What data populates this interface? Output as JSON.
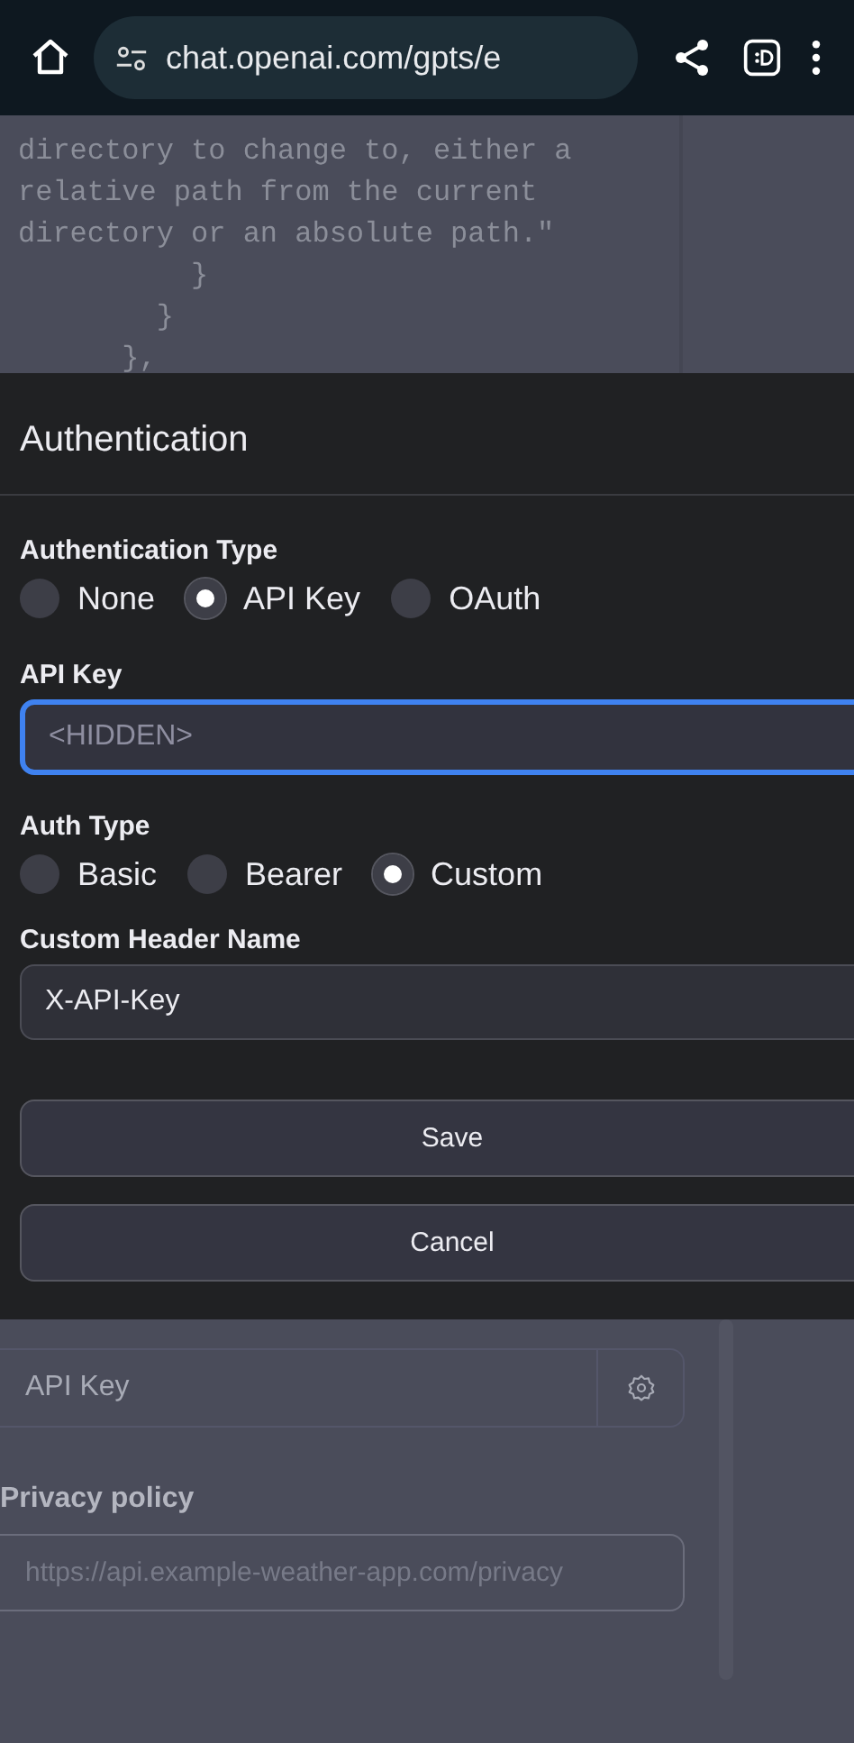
{
  "browser": {
    "url": "chat.openai.com/gpts/e"
  },
  "background_code": {
    "lines": [
      "directory to change to, either a",
      "relative path from the current",
      "directory or an absolute path.\"",
      "          }",
      "        }",
      "      },"
    ]
  },
  "dialog": {
    "title": "Authentication",
    "auth_type_label": "Authentication Type",
    "auth_types": [
      {
        "label": "None",
        "selected": false
      },
      {
        "label": "API Key",
        "selected": true
      },
      {
        "label": "OAuth",
        "selected": false
      }
    ],
    "api_key_label": "API Key",
    "api_key_field": {
      "placeholder": "<HIDDEN>",
      "focused": true
    },
    "auth_subtype_label": "Auth Type",
    "auth_subtypes": [
      {
        "label": "Basic",
        "selected": false
      },
      {
        "label": "Bearer",
        "selected": false
      },
      {
        "label": "Custom",
        "selected": true
      }
    ],
    "header_name_label": "Custom Header Name",
    "header_name_field": {
      "value": "X-API-Key"
    },
    "buttons": [
      "Save",
      "Cancel"
    ]
  },
  "background_form": {
    "authentication_field": {
      "value": "API Key"
    },
    "privacy_label": "Privacy policy",
    "privacy_field": {
      "placeholder": "https://api.example-weather-app.com/privacy"
    }
  }
}
